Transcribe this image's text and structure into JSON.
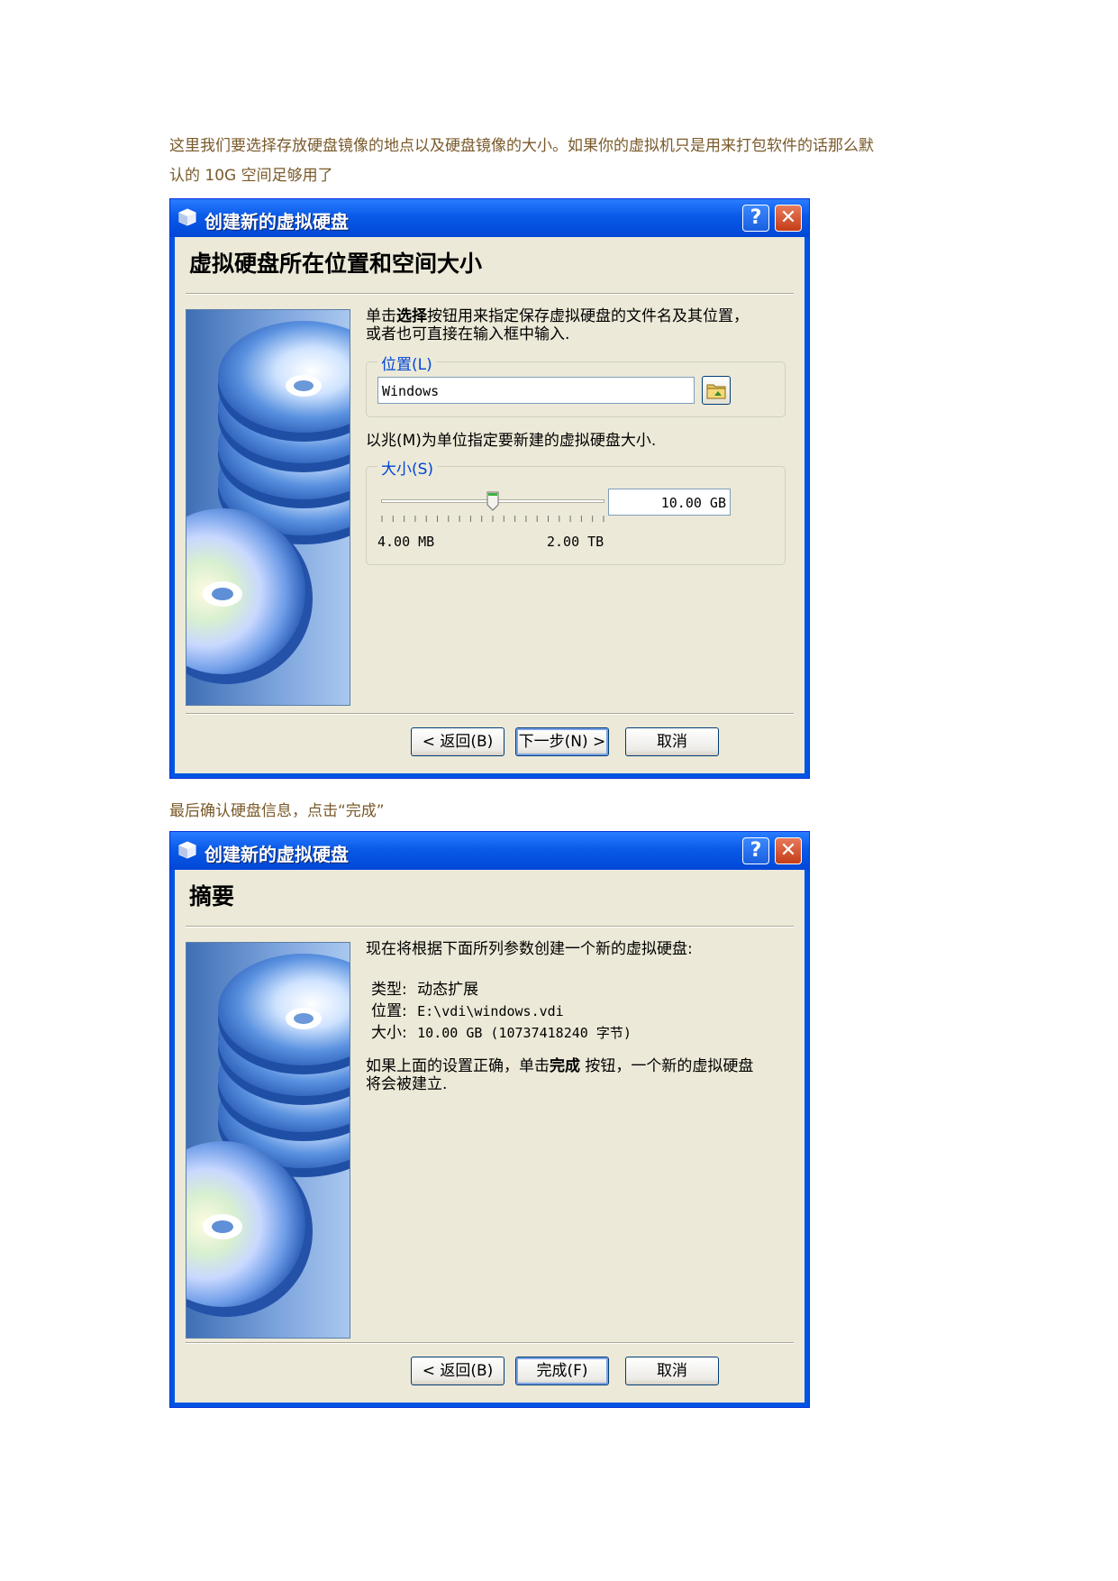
{
  "caption1_line1": "这里我们要选择存放硬盘镜像的地点以及硬盘镜像的大小。如果你的虚拟机只是用来打包软件的话那么默",
  "caption1_line2": "认的 10G 空间足够用了",
  "caption2": "最后确认硬盘信息，点击“完成”",
  "window_title": "创建新的虚拟硬盘",
  "help_label": "?",
  "close_label": "✕",
  "dialog1": {
    "heading": "虚拟硬盘所在位置和空间大小",
    "desc_pre": "单击",
    "desc_bold": "选择",
    "desc_post": "按钮用来指定保存虚拟硬盘的文件名及其位置，或者也可直接在输入框中输入.",
    "location_label": "位置(L)",
    "location_value": "Windows",
    "size_desc": "以兆(M)为单位指定要新建的虚拟硬盘大小.",
    "size_label": "大小(S)",
    "size_value": "10.00 GB",
    "slider_level": 0.5,
    "min_label": "4.00 MB",
    "max_label": "2.00 TB",
    "btn_back": "< 返回(B)",
    "btn_next": "下一步(N) >",
    "btn_cancel": "取消"
  },
  "dialog2": {
    "heading": "摘要",
    "intro": "现在将根据下面所列参数创建一个新的虚拟硬盘:",
    "type_key": "类型:",
    "type_val": "动态扩展",
    "loc_key": "位置:",
    "loc_val": "E:\\vdi\\windows.vdi",
    "size_key": "大小:",
    "size_val": "10.00 GB (10737418240 字节)",
    "note_pre": "如果上面的设置正确，单击",
    "note_bold": "完成",
    "note_post": " 按钮，一个新的虚拟硬盘将会被建立.",
    "btn_back": "< 返回(B)",
    "btn_finish": "完成(F)",
    "btn_cancel": "取消"
  }
}
